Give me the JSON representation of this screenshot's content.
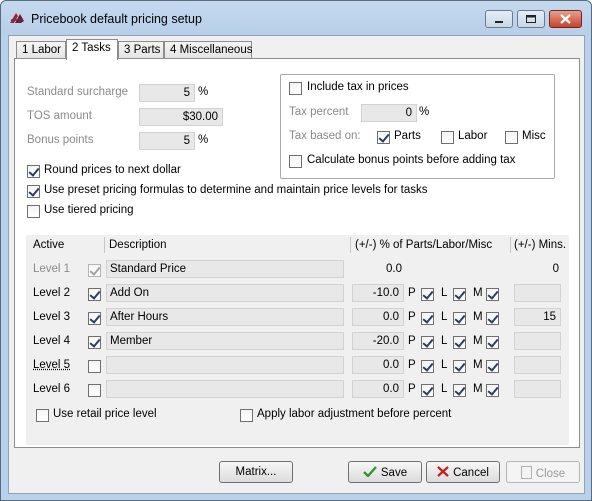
{
  "window": {
    "title": "Pricebook default pricing setup"
  },
  "tabs": [
    {
      "label": "1 Labor",
      "active": false
    },
    {
      "label": "2 Tasks",
      "active": true
    },
    {
      "label": "3 Parts",
      "active": false
    },
    {
      "label": "4 Miscellaneous",
      "active": false
    }
  ],
  "surcharge": {
    "standard_label": "Standard surcharge",
    "standard_value": "5",
    "standard_unit": "%",
    "tos_label": "TOS amount",
    "tos_value": "$30.00",
    "bonus_label": "Bonus points",
    "bonus_value": "5",
    "bonus_unit": "%"
  },
  "tax": {
    "include_label": "Include tax  in prices",
    "include_checked": false,
    "percent_label": "Tax percent",
    "percent_value": "0",
    "percent_unit": "%",
    "based_on_label": "Tax based on:",
    "parts_label": "Parts",
    "parts_checked": true,
    "labor_label": "Labor",
    "labor_checked": false,
    "misc_label": "Misc",
    "misc_checked": false,
    "bonus_before_tax_label": "Calculate bonus points before adding tax",
    "bonus_before_tax_checked": false
  },
  "options": {
    "round_label": "Round prices to next dollar",
    "round_checked": true,
    "preset_label": "Use preset pricing formulas to determine and maintain price levels for tasks",
    "preset_checked": true,
    "tiered_label": "Use tiered pricing",
    "tiered_checked": false
  },
  "grid": {
    "col_active": "Active",
    "col_description": "Description",
    "col_percent": "(+/-) % of Parts/Labor/Misc",
    "col_mins": "(+/-) Mins.",
    "p_label": "P",
    "l_label": "L",
    "m_label": "M",
    "levels": [
      {
        "label": "Level 1",
        "active": true,
        "description": "Standard Price",
        "percent": "0.0",
        "mins": "0",
        "show_plm": false
      },
      {
        "label": "Level 2",
        "active": true,
        "description": "Add On",
        "percent": "-10.0",
        "mins": "",
        "show_plm": true
      },
      {
        "label": "Level 3",
        "active": true,
        "description": "After Hours",
        "percent": "0.0",
        "mins": "15",
        "show_plm": true
      },
      {
        "label": "Level 4",
        "active": true,
        "description": "Member",
        "percent": "-20.0",
        "mins": "",
        "show_plm": true
      },
      {
        "label": "Level 5",
        "active": false,
        "description": "",
        "percent": "0.0",
        "mins": "",
        "show_plm": true
      },
      {
        "label": "Level 6",
        "active": false,
        "description": "",
        "percent": "0.0",
        "mins": "",
        "show_plm": true
      }
    ],
    "retail_label": "Use retail price level",
    "retail_checked": false,
    "labor_adj_label": "Apply labor adjustment before percent",
    "labor_adj_checked": false
  },
  "buttons": {
    "matrix": "Matrix...",
    "save": "Save",
    "cancel": "Cancel",
    "close": "Close"
  },
  "colors": {
    "title_bg": "#b9d1ea",
    "close_btn": "#c7432d",
    "save_check": "#2e9a2e",
    "cancel_x": "#c0221b"
  }
}
